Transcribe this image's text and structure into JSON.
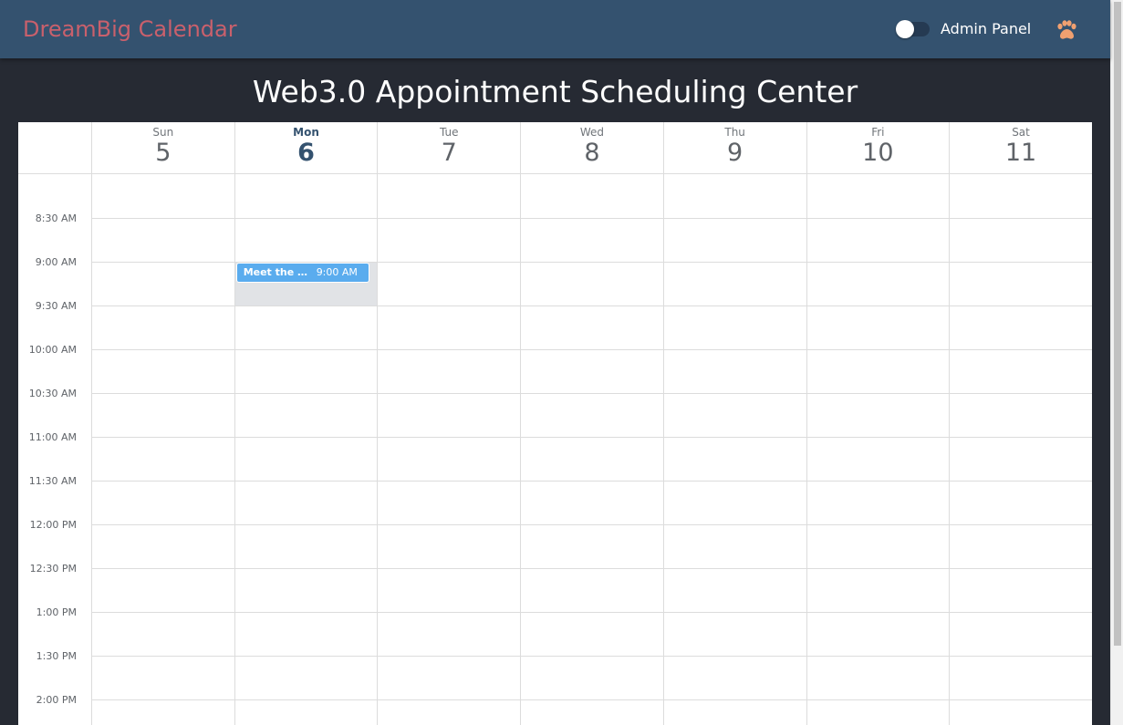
{
  "app": {
    "brand": "DreamBig Calendar",
    "admin_label": "Admin Panel",
    "admin_enabled": false,
    "brand_color": "#c9606c",
    "nav_color": "#34526f"
  },
  "page": {
    "title": "Web3.0 Appointment Scheduling Center"
  },
  "calendar": {
    "days": [
      {
        "name": "Sun",
        "num": "5",
        "today": false
      },
      {
        "name": "Mon",
        "num": "6",
        "today": true
      },
      {
        "name": "Tue",
        "num": "7",
        "today": false
      },
      {
        "name": "Wed",
        "num": "8",
        "today": false
      },
      {
        "name": "Thu",
        "num": "9",
        "today": false
      },
      {
        "name": "Fri",
        "num": "10",
        "today": false
      },
      {
        "name": "Sat",
        "num": "11",
        "today": false
      }
    ],
    "times": [
      "8:30 AM",
      "9:00 AM",
      "9:30 AM",
      "10:00 AM",
      "10:30 AM",
      "11:00 AM",
      "11:30 AM",
      "12:00 PM",
      "12:30 PM",
      "1:00 PM",
      "1:30 PM",
      "2:00 PM"
    ],
    "events": [
      {
        "title": "Meet the wo...",
        "time": "9:00 AM",
        "day_index": 1,
        "start_slot": 1,
        "color": "#5aacee"
      }
    ]
  },
  "icons": {
    "paw": "paw-icon",
    "toggle": "toggle-switch"
  }
}
